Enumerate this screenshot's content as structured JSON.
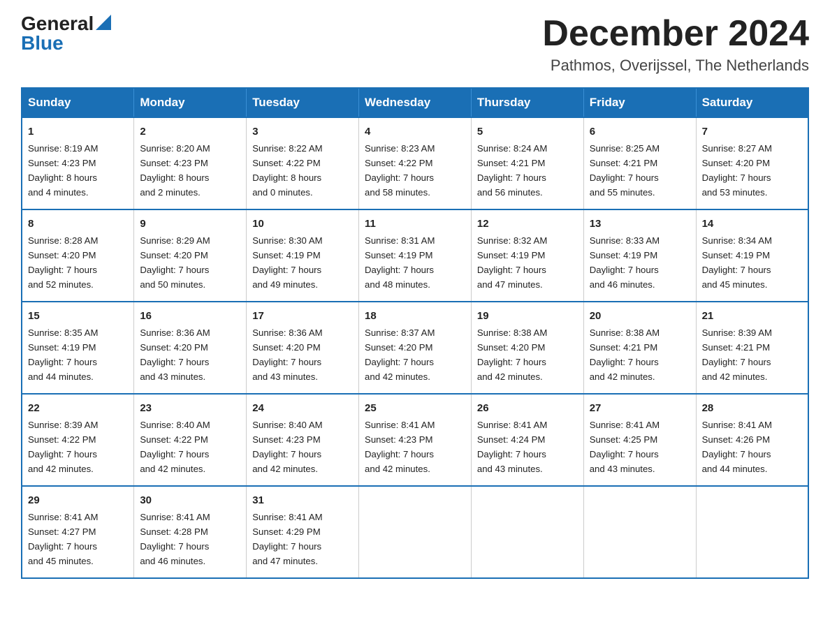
{
  "logo": {
    "general": "General",
    "triangle": "▲",
    "blue": "Blue"
  },
  "header": {
    "title": "December 2024",
    "subtitle": "Pathmos, Overijssel, The Netherlands"
  },
  "weekdays": [
    "Sunday",
    "Monday",
    "Tuesday",
    "Wednesday",
    "Thursday",
    "Friday",
    "Saturday"
  ],
  "weeks": [
    [
      {
        "day": "1",
        "info": "Sunrise: 8:19 AM\nSunset: 4:23 PM\nDaylight: 8 hours\nand 4 minutes."
      },
      {
        "day": "2",
        "info": "Sunrise: 8:20 AM\nSunset: 4:23 PM\nDaylight: 8 hours\nand 2 minutes."
      },
      {
        "day": "3",
        "info": "Sunrise: 8:22 AM\nSunset: 4:22 PM\nDaylight: 8 hours\nand 0 minutes."
      },
      {
        "day": "4",
        "info": "Sunrise: 8:23 AM\nSunset: 4:22 PM\nDaylight: 7 hours\nand 58 minutes."
      },
      {
        "day": "5",
        "info": "Sunrise: 8:24 AM\nSunset: 4:21 PM\nDaylight: 7 hours\nand 56 minutes."
      },
      {
        "day": "6",
        "info": "Sunrise: 8:25 AM\nSunset: 4:21 PM\nDaylight: 7 hours\nand 55 minutes."
      },
      {
        "day": "7",
        "info": "Sunrise: 8:27 AM\nSunset: 4:20 PM\nDaylight: 7 hours\nand 53 minutes."
      }
    ],
    [
      {
        "day": "8",
        "info": "Sunrise: 8:28 AM\nSunset: 4:20 PM\nDaylight: 7 hours\nand 52 minutes."
      },
      {
        "day": "9",
        "info": "Sunrise: 8:29 AM\nSunset: 4:20 PM\nDaylight: 7 hours\nand 50 minutes."
      },
      {
        "day": "10",
        "info": "Sunrise: 8:30 AM\nSunset: 4:19 PM\nDaylight: 7 hours\nand 49 minutes."
      },
      {
        "day": "11",
        "info": "Sunrise: 8:31 AM\nSunset: 4:19 PM\nDaylight: 7 hours\nand 48 minutes."
      },
      {
        "day": "12",
        "info": "Sunrise: 8:32 AM\nSunset: 4:19 PM\nDaylight: 7 hours\nand 47 minutes."
      },
      {
        "day": "13",
        "info": "Sunrise: 8:33 AM\nSunset: 4:19 PM\nDaylight: 7 hours\nand 46 minutes."
      },
      {
        "day": "14",
        "info": "Sunrise: 8:34 AM\nSunset: 4:19 PM\nDaylight: 7 hours\nand 45 minutes."
      }
    ],
    [
      {
        "day": "15",
        "info": "Sunrise: 8:35 AM\nSunset: 4:19 PM\nDaylight: 7 hours\nand 44 minutes."
      },
      {
        "day": "16",
        "info": "Sunrise: 8:36 AM\nSunset: 4:20 PM\nDaylight: 7 hours\nand 43 minutes."
      },
      {
        "day": "17",
        "info": "Sunrise: 8:36 AM\nSunset: 4:20 PM\nDaylight: 7 hours\nand 43 minutes."
      },
      {
        "day": "18",
        "info": "Sunrise: 8:37 AM\nSunset: 4:20 PM\nDaylight: 7 hours\nand 42 minutes."
      },
      {
        "day": "19",
        "info": "Sunrise: 8:38 AM\nSunset: 4:20 PM\nDaylight: 7 hours\nand 42 minutes."
      },
      {
        "day": "20",
        "info": "Sunrise: 8:38 AM\nSunset: 4:21 PM\nDaylight: 7 hours\nand 42 minutes."
      },
      {
        "day": "21",
        "info": "Sunrise: 8:39 AM\nSunset: 4:21 PM\nDaylight: 7 hours\nand 42 minutes."
      }
    ],
    [
      {
        "day": "22",
        "info": "Sunrise: 8:39 AM\nSunset: 4:22 PM\nDaylight: 7 hours\nand 42 minutes."
      },
      {
        "day": "23",
        "info": "Sunrise: 8:40 AM\nSunset: 4:22 PM\nDaylight: 7 hours\nand 42 minutes."
      },
      {
        "day": "24",
        "info": "Sunrise: 8:40 AM\nSunset: 4:23 PM\nDaylight: 7 hours\nand 42 minutes."
      },
      {
        "day": "25",
        "info": "Sunrise: 8:41 AM\nSunset: 4:23 PM\nDaylight: 7 hours\nand 42 minutes."
      },
      {
        "day": "26",
        "info": "Sunrise: 8:41 AM\nSunset: 4:24 PM\nDaylight: 7 hours\nand 43 minutes."
      },
      {
        "day": "27",
        "info": "Sunrise: 8:41 AM\nSunset: 4:25 PM\nDaylight: 7 hours\nand 43 minutes."
      },
      {
        "day": "28",
        "info": "Sunrise: 8:41 AM\nSunset: 4:26 PM\nDaylight: 7 hours\nand 44 minutes."
      }
    ],
    [
      {
        "day": "29",
        "info": "Sunrise: 8:41 AM\nSunset: 4:27 PM\nDaylight: 7 hours\nand 45 minutes."
      },
      {
        "day": "30",
        "info": "Sunrise: 8:41 AM\nSunset: 4:28 PM\nDaylight: 7 hours\nand 46 minutes."
      },
      {
        "day": "31",
        "info": "Sunrise: 8:41 AM\nSunset: 4:29 PM\nDaylight: 7 hours\nand 47 minutes."
      },
      {
        "day": "",
        "info": ""
      },
      {
        "day": "",
        "info": ""
      },
      {
        "day": "",
        "info": ""
      },
      {
        "day": "",
        "info": ""
      }
    ]
  ]
}
